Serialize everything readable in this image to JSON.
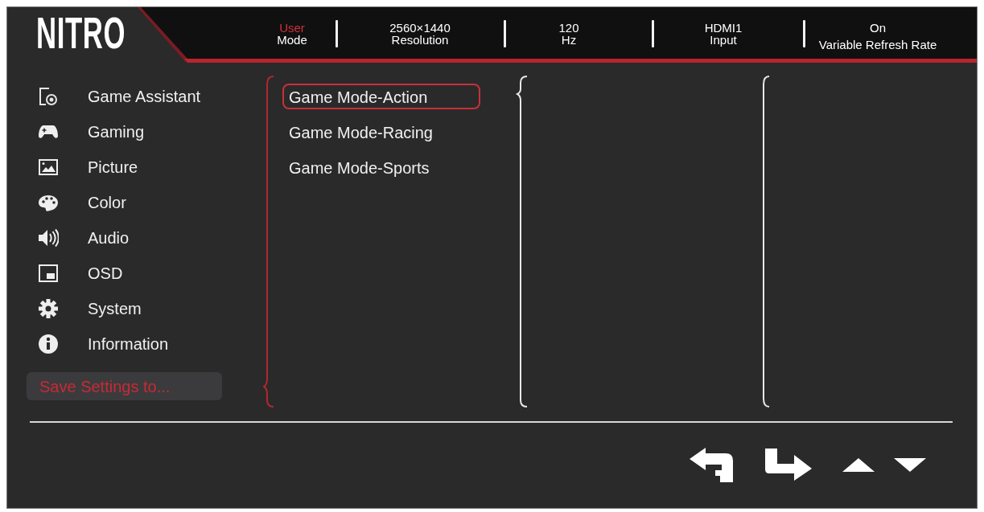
{
  "logo": "NITRO",
  "status_bar": [
    {
      "value": "User",
      "label": "Mode",
      "highlighted": true
    },
    {
      "value": "2560×1440",
      "label": "Resolution",
      "highlighted": false
    },
    {
      "value": "120",
      "label": "Hz",
      "highlighted": false
    },
    {
      "value": "HDMI1",
      "label": "Input",
      "highlighted": false
    },
    {
      "value": "On",
      "label": "Variable Refresh Rate",
      "highlighted": false
    }
  ],
  "sidebar": {
    "items": [
      {
        "label": "Game Assistant"
      },
      {
        "label": "Gaming"
      },
      {
        "label": "Picture"
      },
      {
        "label": "Color"
      },
      {
        "label": "Audio"
      },
      {
        "label": "OSD"
      },
      {
        "label": "System"
      },
      {
        "label": "Information"
      }
    ],
    "save_button": {
      "label": "Save Settings to..."
    }
  },
  "panels": [
    {
      "active": true,
      "items": [
        {
          "label": "Game Mode-Action",
          "selected": true
        },
        {
          "label": "Game Mode-Racing",
          "selected": false
        },
        {
          "label": "Game Mode-Sports",
          "selected": false
        }
      ]
    },
    {
      "active": false
    },
    {
      "active": false
    }
  ]
}
